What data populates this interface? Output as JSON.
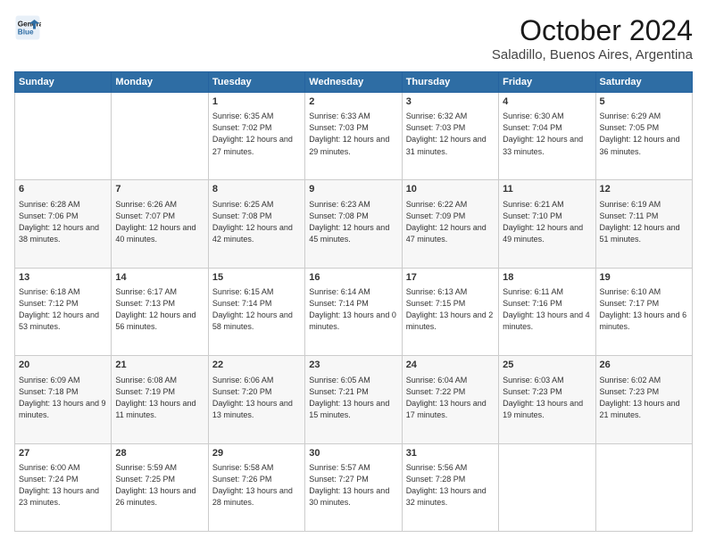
{
  "logo": {
    "line1": "General",
    "line2": "Blue"
  },
  "header": {
    "month": "October 2024",
    "location": "Saladillo, Buenos Aires, Argentina"
  },
  "weekdays": [
    "Sunday",
    "Monday",
    "Tuesday",
    "Wednesday",
    "Thursday",
    "Friday",
    "Saturday"
  ],
  "weeks": [
    [
      {
        "day": "",
        "sunrise": "",
        "sunset": "",
        "daylight": ""
      },
      {
        "day": "",
        "sunrise": "",
        "sunset": "",
        "daylight": ""
      },
      {
        "day": "1",
        "sunrise": "Sunrise: 6:35 AM",
        "sunset": "Sunset: 7:02 PM",
        "daylight": "Daylight: 12 hours and 27 minutes."
      },
      {
        "day": "2",
        "sunrise": "Sunrise: 6:33 AM",
        "sunset": "Sunset: 7:03 PM",
        "daylight": "Daylight: 12 hours and 29 minutes."
      },
      {
        "day": "3",
        "sunrise": "Sunrise: 6:32 AM",
        "sunset": "Sunset: 7:03 PM",
        "daylight": "Daylight: 12 hours and 31 minutes."
      },
      {
        "day": "4",
        "sunrise": "Sunrise: 6:30 AM",
        "sunset": "Sunset: 7:04 PM",
        "daylight": "Daylight: 12 hours and 33 minutes."
      },
      {
        "day": "5",
        "sunrise": "Sunrise: 6:29 AM",
        "sunset": "Sunset: 7:05 PM",
        "daylight": "Daylight: 12 hours and 36 minutes."
      }
    ],
    [
      {
        "day": "6",
        "sunrise": "Sunrise: 6:28 AM",
        "sunset": "Sunset: 7:06 PM",
        "daylight": "Daylight: 12 hours and 38 minutes."
      },
      {
        "day": "7",
        "sunrise": "Sunrise: 6:26 AM",
        "sunset": "Sunset: 7:07 PM",
        "daylight": "Daylight: 12 hours and 40 minutes."
      },
      {
        "day": "8",
        "sunrise": "Sunrise: 6:25 AM",
        "sunset": "Sunset: 7:08 PM",
        "daylight": "Daylight: 12 hours and 42 minutes."
      },
      {
        "day": "9",
        "sunrise": "Sunrise: 6:23 AM",
        "sunset": "Sunset: 7:08 PM",
        "daylight": "Daylight: 12 hours and 45 minutes."
      },
      {
        "day": "10",
        "sunrise": "Sunrise: 6:22 AM",
        "sunset": "Sunset: 7:09 PM",
        "daylight": "Daylight: 12 hours and 47 minutes."
      },
      {
        "day": "11",
        "sunrise": "Sunrise: 6:21 AM",
        "sunset": "Sunset: 7:10 PM",
        "daylight": "Daylight: 12 hours and 49 minutes."
      },
      {
        "day": "12",
        "sunrise": "Sunrise: 6:19 AM",
        "sunset": "Sunset: 7:11 PM",
        "daylight": "Daylight: 12 hours and 51 minutes."
      }
    ],
    [
      {
        "day": "13",
        "sunrise": "Sunrise: 6:18 AM",
        "sunset": "Sunset: 7:12 PM",
        "daylight": "Daylight: 12 hours and 53 minutes."
      },
      {
        "day": "14",
        "sunrise": "Sunrise: 6:17 AM",
        "sunset": "Sunset: 7:13 PM",
        "daylight": "Daylight: 12 hours and 56 minutes."
      },
      {
        "day": "15",
        "sunrise": "Sunrise: 6:15 AM",
        "sunset": "Sunset: 7:14 PM",
        "daylight": "Daylight: 12 hours and 58 minutes."
      },
      {
        "day": "16",
        "sunrise": "Sunrise: 6:14 AM",
        "sunset": "Sunset: 7:14 PM",
        "daylight": "Daylight: 13 hours and 0 minutes."
      },
      {
        "day": "17",
        "sunrise": "Sunrise: 6:13 AM",
        "sunset": "Sunset: 7:15 PM",
        "daylight": "Daylight: 13 hours and 2 minutes."
      },
      {
        "day": "18",
        "sunrise": "Sunrise: 6:11 AM",
        "sunset": "Sunset: 7:16 PM",
        "daylight": "Daylight: 13 hours and 4 minutes."
      },
      {
        "day": "19",
        "sunrise": "Sunrise: 6:10 AM",
        "sunset": "Sunset: 7:17 PM",
        "daylight": "Daylight: 13 hours and 6 minutes."
      }
    ],
    [
      {
        "day": "20",
        "sunrise": "Sunrise: 6:09 AM",
        "sunset": "Sunset: 7:18 PM",
        "daylight": "Daylight: 13 hours and 9 minutes."
      },
      {
        "day": "21",
        "sunrise": "Sunrise: 6:08 AM",
        "sunset": "Sunset: 7:19 PM",
        "daylight": "Daylight: 13 hours and 11 minutes."
      },
      {
        "day": "22",
        "sunrise": "Sunrise: 6:06 AM",
        "sunset": "Sunset: 7:20 PM",
        "daylight": "Daylight: 13 hours and 13 minutes."
      },
      {
        "day": "23",
        "sunrise": "Sunrise: 6:05 AM",
        "sunset": "Sunset: 7:21 PM",
        "daylight": "Daylight: 13 hours and 15 minutes."
      },
      {
        "day": "24",
        "sunrise": "Sunrise: 6:04 AM",
        "sunset": "Sunset: 7:22 PM",
        "daylight": "Daylight: 13 hours and 17 minutes."
      },
      {
        "day": "25",
        "sunrise": "Sunrise: 6:03 AM",
        "sunset": "Sunset: 7:23 PM",
        "daylight": "Daylight: 13 hours and 19 minutes."
      },
      {
        "day": "26",
        "sunrise": "Sunrise: 6:02 AM",
        "sunset": "Sunset: 7:23 PM",
        "daylight": "Daylight: 13 hours and 21 minutes."
      }
    ],
    [
      {
        "day": "27",
        "sunrise": "Sunrise: 6:00 AM",
        "sunset": "Sunset: 7:24 PM",
        "daylight": "Daylight: 13 hours and 23 minutes."
      },
      {
        "day": "28",
        "sunrise": "Sunrise: 5:59 AM",
        "sunset": "Sunset: 7:25 PM",
        "daylight": "Daylight: 13 hours and 26 minutes."
      },
      {
        "day": "29",
        "sunrise": "Sunrise: 5:58 AM",
        "sunset": "Sunset: 7:26 PM",
        "daylight": "Daylight: 13 hours and 28 minutes."
      },
      {
        "day": "30",
        "sunrise": "Sunrise: 5:57 AM",
        "sunset": "Sunset: 7:27 PM",
        "daylight": "Daylight: 13 hours and 30 minutes."
      },
      {
        "day": "31",
        "sunrise": "Sunrise: 5:56 AM",
        "sunset": "Sunset: 7:28 PM",
        "daylight": "Daylight: 13 hours and 32 minutes."
      },
      {
        "day": "",
        "sunrise": "",
        "sunset": "",
        "daylight": ""
      },
      {
        "day": "",
        "sunrise": "",
        "sunset": "",
        "daylight": ""
      }
    ]
  ]
}
